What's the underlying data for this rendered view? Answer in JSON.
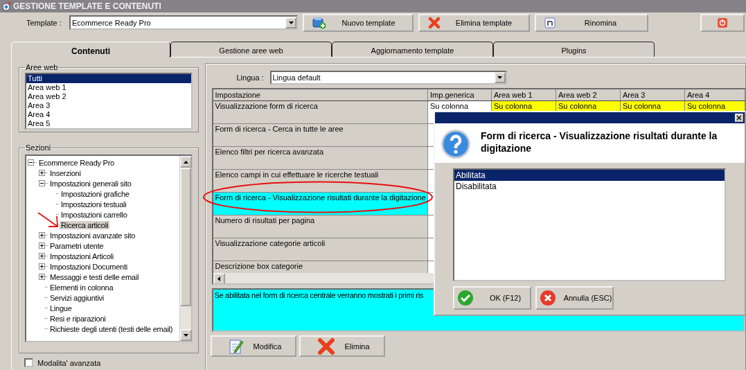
{
  "window": {
    "title": "GESTIONE TEMPLATE E CONTENUTI"
  },
  "toolbar": {
    "template_label": "Template :",
    "template": "Ecommerce Ready Pro",
    "buttons": [
      {
        "label": "Nuovo template",
        "kind": "new"
      },
      {
        "label": "Elimina template",
        "kind": "delete"
      },
      {
        "label": "Rinomina",
        "kind": "rename"
      },
      {
        "kind": "power"
      }
    ]
  },
  "tabs": [
    {
      "label": "Contenuti",
      "selected": true
    },
    {
      "label": "Gestione aree web",
      "selected": false
    },
    {
      "label": "Aggiornamento template",
      "selected": false
    },
    {
      "label": "Plugins",
      "selected": false
    }
  ],
  "aree_web": {
    "title": "Aree web",
    "items": [
      {
        "label": "Tutti",
        "selected": true
      },
      {
        "label": "Area web 1",
        "selected": false
      },
      {
        "label": "Area web 2",
        "selected": false
      },
      {
        "label": "Area 3",
        "selected": false
      },
      {
        "label": "Area 4",
        "selected": false
      },
      {
        "label": "Area 5",
        "selected": false
      }
    ]
  },
  "sezioni": {
    "title": "Sezioni",
    "tree": [
      {
        "label": "Ecommerce Ready Pro",
        "expanded": true,
        "selected": false,
        "children": [
          {
            "label": "Inserzioni",
            "expanded": false,
            "selected": false
          },
          {
            "label": "Impostazioni generali sito",
            "expanded": true,
            "selected": false,
            "children": [
              {
                "label": "Impostazioni grafiche",
                "selected": false
              },
              {
                "label": "Impostazioni testuali",
                "selected": false
              },
              {
                "label": "Impostazioni carrello",
                "selected": false
              },
              {
                "label": "Ricerca articoli",
                "selected": true
              }
            ]
          },
          {
            "label": "Impostazioni avanzate sito",
            "expanded": false,
            "selected": false
          },
          {
            "label": "Parametri utente",
            "expanded": false,
            "selected": false
          },
          {
            "label": "Impostazioni Articoli",
            "expanded": false,
            "selected": false
          },
          {
            "label": "Impostazioni Documenti",
            "expanded": false,
            "selected": false
          },
          {
            "label": "Messaggi e testi delle email",
            "expanded": false,
            "selected": false
          },
          {
            "label": "Elementi in colonna",
            "selected": false
          },
          {
            "label": "Servizi aggiuntivi",
            "selected": false
          },
          {
            "label": "Lingue",
            "selected": false
          },
          {
            "label": "Resi e riparazioni",
            "selected": false
          },
          {
            "label": "Richieste degli utenti (testi delle email)",
            "selected": false
          }
        ]
      }
    ]
  },
  "advanced_mode": {
    "label": "Modalita' avanzata",
    "checked": false
  },
  "lingua": {
    "label": "Lingua :",
    "value": "Lingua default"
  },
  "table": {
    "columns": [
      "Impostazione",
      "Imp.generica",
      "Area web 1",
      "Area web 2",
      "Area 3",
      "Area 4"
    ],
    "rows": [
      {
        "setting": "Visualizzazione form di ricerca",
        "selected": false,
        "values": [
          {
            "text": "Su colonna",
            "highlighted": false
          },
          {
            "text": "Su colonna",
            "highlighted": true
          },
          {
            "text": "Su colonna",
            "highlighted": true
          },
          {
            "text": "Su colonna",
            "highlighted": true
          },
          {
            "text": "Su colonna",
            "highlighted": true
          }
        ]
      },
      {
        "setting": "Form di ricerca - Cerca in tutte le aree",
        "selected": false
      },
      {
        "setting": "Elenco filtri per ricerca avanzata",
        "selected": false
      },
      {
        "setting": "Elenco campi in cui effettuare le ricerche testuali",
        "selected": false
      },
      {
        "setting": "Form di ricerca - Visualizzazione risultati durante la digitazione",
        "selected": true
      },
      {
        "setting": "Numero di risultati per pagina",
        "selected": false
      },
      {
        "setting": "Visualizzazione categorie articoli",
        "selected": false
      },
      {
        "setting": "Descrizione box categorie",
        "selected": false
      }
    ]
  },
  "description": "Se abilitata nel form di ricerca centrale verranno mostrati i primi ris",
  "actions": [
    {
      "label": "Modifica",
      "kind": "edit"
    },
    {
      "label": "Elimina",
      "kind": "delete"
    }
  ],
  "dialog": {
    "heading": "Form di ricerca - Visualizzazione risultati durante la digitazione",
    "options": [
      {
        "label": "Abilitata",
        "selected": true
      },
      {
        "label": "Disabilitata",
        "selected": false
      }
    ],
    "buttons": [
      {
        "label": "OK (F12)",
        "kind": "ok"
      },
      {
        "label": "Annulla (ESC)",
        "kind": "cancel"
      }
    ]
  },
  "annotations": {
    "ellipse": true,
    "arrow": true
  }
}
